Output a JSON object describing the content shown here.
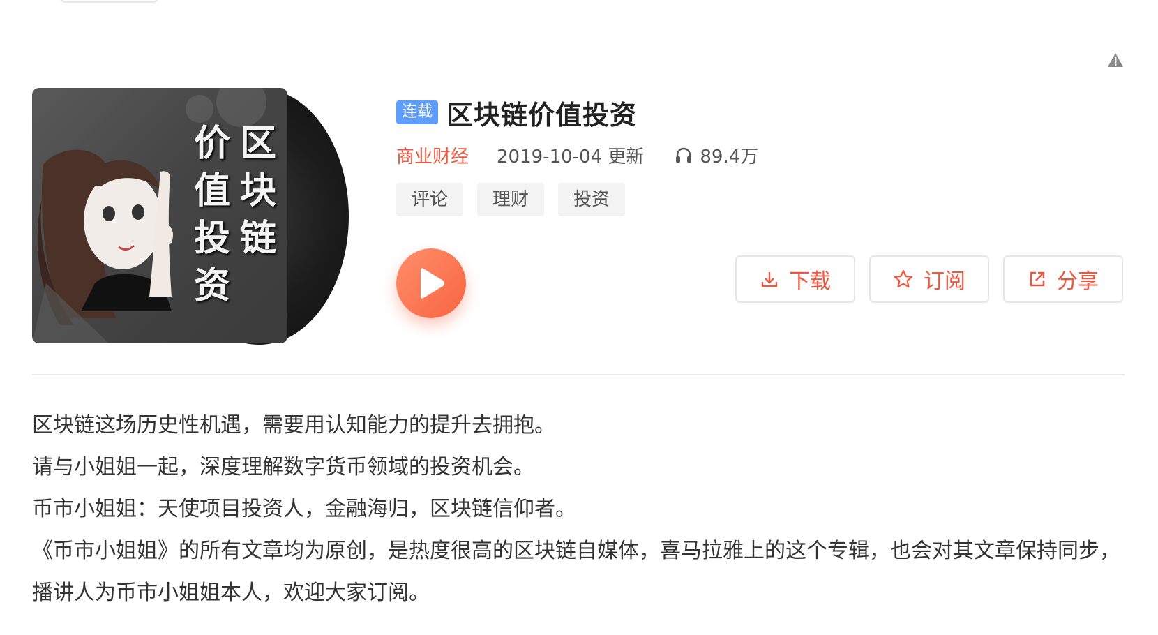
{
  "album": {
    "status_badge": "连载",
    "title": "区块链价值投资",
    "category": "商业财经",
    "update_date": "2019-10-04 更新",
    "play_count": "89.4万",
    "tags": [
      "评论",
      "理财",
      "投资"
    ]
  },
  "cover": {
    "chars": [
      "价",
      "区",
      "值",
      "块",
      "投",
      "链",
      "资",
      ""
    ]
  },
  "actions": {
    "download_label": "下载",
    "subscribe_label": "订阅",
    "share_label": "分享"
  },
  "colors": {
    "accent": "#f0573e",
    "badge": "#5d9dfc"
  },
  "icons": {
    "report": "warning-triangle-icon",
    "play_count": "headphones-icon",
    "play": "play-icon",
    "download": "download-icon",
    "subscribe": "star-icon",
    "share": "share-icon"
  },
  "intro": {
    "paragraphs": [
      "区块链这场历史性机遇，需要用认知能力的提升去拥抱。",
      "请与小姐姐一起，深度理解数字货币领域的投资机会。",
      "币市小姐姐：天使项目投资人，金融海归，区块链信仰者。",
      "《币市小姐姐》的所有文章均为原创，是热度很高的区块链自媒体，喜马拉雅上的这个专辑，也会对其文章保持同步，播讲人为币市小姐姐本人，欢迎大家订阅。"
    ]
  }
}
